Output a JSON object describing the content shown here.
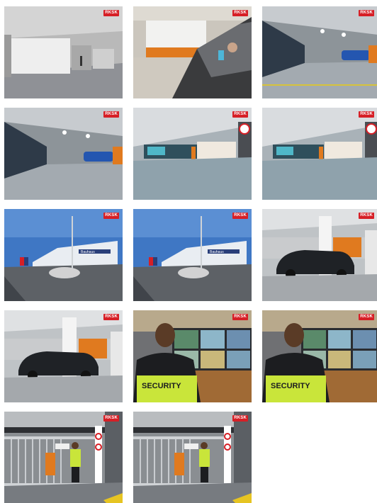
{
  "watermark": "RKSK",
  "banner_text": "Bauhaus",
  "vest_text": "SECURITY",
  "colors": {
    "accent_red": "#d61f26",
    "orange_pillar": "#e07a1f",
    "vest_yellow": "#c9e53a",
    "sky_blue": "#3f77c4"
  },
  "thumbnails": [
    {
      "id": 1,
      "subject": "empty-garage-door"
    },
    {
      "id": 2,
      "subject": "car-driver-phone"
    },
    {
      "id": 3,
      "subject": "garage-aisle-blue-car"
    },
    {
      "id": 4,
      "subject": "garage-aisle-blue-car"
    },
    {
      "id": 5,
      "subject": "garage-entrance-gate"
    },
    {
      "id": 6,
      "subject": "garage-entrance-gate"
    },
    {
      "id": 7,
      "subject": "building-exterior-road"
    },
    {
      "id": 8,
      "subject": "building-exterior-road"
    },
    {
      "id": 9,
      "subject": "parked-dark-suv"
    },
    {
      "id": 10,
      "subject": "parked-dark-suv"
    },
    {
      "id": 11,
      "subject": "security-guard-monitors"
    },
    {
      "id": 12,
      "subject": "security-guard-monitors"
    },
    {
      "id": 13,
      "subject": "barrier-gate-guard"
    },
    {
      "id": 14,
      "subject": "barrier-gate-guard"
    }
  ]
}
